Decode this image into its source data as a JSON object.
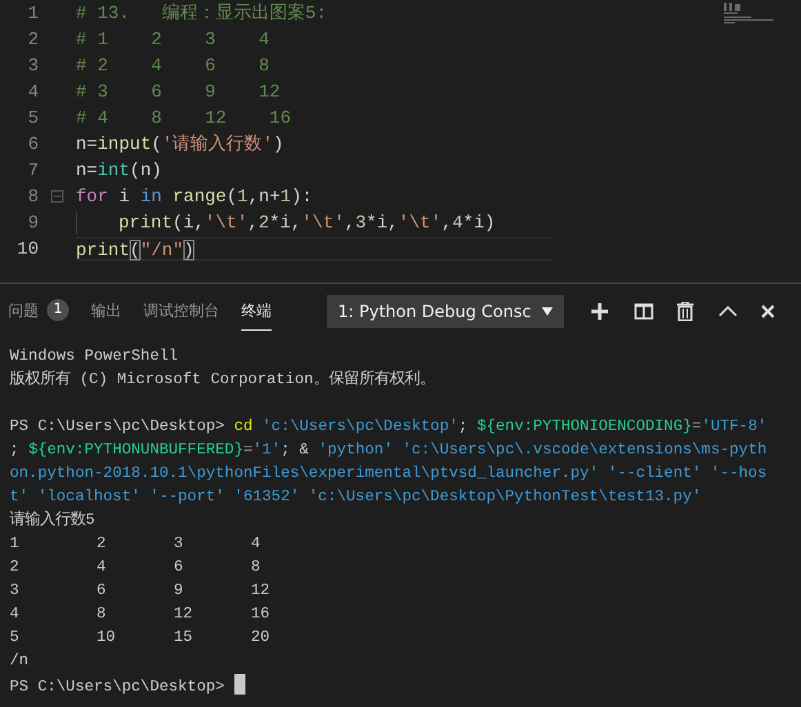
{
  "editor": {
    "lines": [
      {
        "number": "1",
        "current": false,
        "tokens": [
          {
            "kind": "comment",
            "text": "# 13.   编程：显示出图案5:"
          }
        ]
      },
      {
        "number": "2",
        "current": false,
        "tokens": [
          {
            "kind": "comment",
            "text": "# 1    2    3    4"
          }
        ]
      },
      {
        "number": "3",
        "current": false,
        "tokens": [
          {
            "kind": "comment",
            "text": "# 2    4    6    8"
          }
        ]
      },
      {
        "number": "4",
        "current": false,
        "tokens": [
          {
            "kind": "comment",
            "text": "# 3    6    9    12"
          }
        ]
      },
      {
        "number": "5",
        "current": false,
        "tokens": [
          {
            "kind": "comment",
            "text": "# 4    8    12    16"
          }
        ]
      },
      {
        "number": "6",
        "current": false,
        "tokens": [
          {
            "kind": "plain",
            "text": "n="
          },
          {
            "kind": "function",
            "text": "input"
          },
          {
            "kind": "plain",
            "text": "("
          },
          {
            "kind": "string",
            "text": "'请输入行数'"
          },
          {
            "kind": "plain",
            "text": ")"
          }
        ]
      },
      {
        "number": "7",
        "current": false,
        "tokens": [
          {
            "kind": "plain",
            "text": "n="
          },
          {
            "kind": "builtin",
            "text": "int"
          },
          {
            "kind": "plain",
            "text": "(n)"
          }
        ]
      },
      {
        "number": "8",
        "current": false,
        "folding": true,
        "tokens": [
          {
            "kind": "control",
            "text": "for"
          },
          {
            "kind": "plain",
            "text": " i "
          },
          {
            "kind": "keyword",
            "text": "in",
            "space_after": true
          },
          {
            "kind": "function",
            "text": "range"
          },
          {
            "kind": "plain",
            "text": "("
          },
          {
            "kind": "number",
            "text": "1"
          },
          {
            "kind": "plain",
            "text": ",n+"
          },
          {
            "kind": "number",
            "text": "1"
          },
          {
            "kind": "plain",
            "text": "):"
          }
        ]
      },
      {
        "number": "9",
        "current": false,
        "indent": true,
        "tokens": [
          {
            "kind": "function",
            "text": "print"
          },
          {
            "kind": "plain",
            "text": "(i,"
          },
          {
            "kind": "string",
            "text": "'\\t'"
          },
          {
            "kind": "plain",
            "text": ","
          },
          {
            "kind": "number",
            "text": "2"
          },
          {
            "kind": "plain",
            "text": "*i,"
          },
          {
            "kind": "string",
            "text": "'\\t'"
          },
          {
            "kind": "plain",
            "text": ","
          },
          {
            "kind": "number",
            "text": "3"
          },
          {
            "kind": "plain",
            "text": "*i,"
          },
          {
            "kind": "string",
            "text": "'\\t'"
          },
          {
            "kind": "plain",
            "text": ","
          },
          {
            "kind": "number",
            "text": "4"
          },
          {
            "kind": "plain",
            "text": "*i)"
          }
        ]
      },
      {
        "number": "10",
        "current": true,
        "tokens": [
          {
            "kind": "function",
            "text": "print"
          },
          {
            "kind": "bracket",
            "text": "("
          },
          {
            "kind": "string",
            "text": "\"/n\""
          },
          {
            "kind": "bracket",
            "text": ")"
          }
        ]
      }
    ]
  },
  "panel": {
    "tabs": [
      {
        "label": "问题",
        "badge": "1",
        "selected": false
      },
      {
        "label": "输出",
        "selected": false
      },
      {
        "label": "调试控制台",
        "selected": false
      },
      {
        "label": "终端",
        "selected": true
      }
    ],
    "terminal_select": "1: Python Debug Consc"
  },
  "terminal": [
    {
      "kind": "line",
      "tokens": [
        {
          "kind": "plain",
          "text": "Windows PowerShell"
        }
      ]
    },
    {
      "kind": "line",
      "tokens": [
        {
          "kind": "plain",
          "text": "版权所有 (C) Microsoft Corporation。保留所有权利。"
        }
      ]
    },
    {
      "kind": "blank"
    },
    {
      "kind": "line",
      "tokens": [
        {
          "kind": "plain",
          "text": "PS C:\\Users\\pc\\Desktop> "
        },
        {
          "kind": "command",
          "text": "cd",
          "space_after": true
        },
        {
          "kind": "string",
          "text": "'c:\\Users\\pc\\Desktop'"
        },
        {
          "kind": "plain",
          "text": "; "
        },
        {
          "kind": "variable",
          "text": "${env:PYTHONIOENCODING}"
        },
        {
          "kind": "operator",
          "text": "="
        },
        {
          "kind": "string",
          "text": "'UTF-8'"
        }
      ]
    },
    {
      "kind": "line",
      "tokens": [
        {
          "kind": "plain",
          "text": "; "
        },
        {
          "kind": "variable",
          "text": "${env:PYTHONUNBUFFERED}"
        },
        {
          "kind": "operator",
          "text": "="
        },
        {
          "kind": "string",
          "text": "'1'"
        },
        {
          "kind": "plain",
          "text": "; & "
        },
        {
          "kind": "string",
          "text": "'python'",
          "space_after": true
        },
        {
          "kind": "string",
          "text": "'c:\\Users\\pc\\.vscode\\extensions\\ms-pyth"
        }
      ]
    },
    {
      "kind": "line",
      "tokens": [
        {
          "kind": "string",
          "text": "on.python-2018.10.1\\pythonFiles\\experimental\\ptvsd_launcher.py'",
          "space_after": true
        },
        {
          "kind": "string",
          "text": "'--client'",
          "space_after": true
        },
        {
          "kind": "string",
          "text": "'--hos"
        }
      ]
    },
    {
      "kind": "line",
      "tokens": [
        {
          "kind": "string",
          "text": "t'",
          "space_after": true
        },
        {
          "kind": "string",
          "text": "'localhost'",
          "space_after": true
        },
        {
          "kind": "string",
          "text": "'--port'",
          "space_after": true
        },
        {
          "kind": "string",
          "text": "'61352'",
          "space_after": true
        },
        {
          "kind": "string",
          "text": "'c:\\Users\\pc\\Desktop\\PythonTest\\test13.py'"
        }
      ]
    },
    {
      "kind": "line",
      "tokens": [
        {
          "kind": "plain",
          "text": "请输入行数5"
        }
      ]
    },
    {
      "kind": "table",
      "rows": [
        [
          "1",
          "2",
          "3",
          "4"
        ],
        [
          "2",
          "4",
          "6",
          "8"
        ],
        [
          "3",
          "6",
          "9",
          "12"
        ],
        [
          "4",
          "8",
          "12",
          "16"
        ],
        [
          "5",
          "10",
          "15",
          "20"
        ]
      ]
    },
    {
      "kind": "line",
      "tokens": [
        {
          "kind": "plain",
          "text": "/n"
        }
      ]
    },
    {
      "kind": "prompt",
      "text": "PS C:\\Users\\pc\\Desktop>",
      "cursor": true
    }
  ]
}
